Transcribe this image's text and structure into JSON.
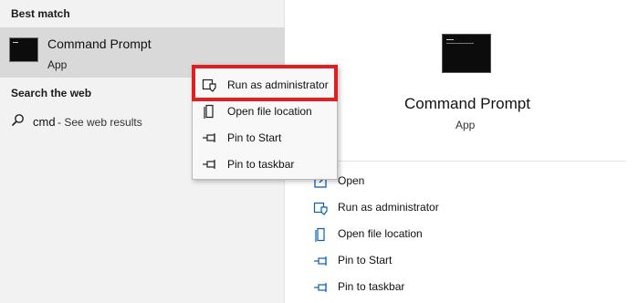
{
  "left": {
    "best_match_header": "Best match",
    "best_match": {
      "title": "Command Prompt",
      "subtitle": "App",
      "icon": "cmd-app-icon"
    },
    "search_web_header": "Search the web",
    "web_result": {
      "query": "cmd",
      "suffix": " - See web results",
      "icon": "search-icon"
    }
  },
  "context_menu": {
    "items": [
      {
        "label": "Run as administrator",
        "icon": "shield-icon"
      },
      {
        "label": "Open file location",
        "icon": "file-location-icon"
      },
      {
        "label": "Pin to Start",
        "icon": "pin-icon"
      },
      {
        "label": "Pin to taskbar",
        "icon": "pin-icon"
      }
    ],
    "highlight_color": "#e02020"
  },
  "details": {
    "title": "Command Prompt",
    "subtitle": "App",
    "icon": "cmd-app-icon",
    "actions": [
      {
        "label": "Open",
        "icon": "open-icon"
      },
      {
        "label": "Run as administrator",
        "icon": "shield-icon"
      },
      {
        "label": "Open file location",
        "icon": "file-location-icon"
      },
      {
        "label": "Pin to Start",
        "icon": "pin-icon"
      },
      {
        "label": "Pin to taskbar",
        "icon": "pin-icon"
      }
    ],
    "accent_color": "#0a5fb4"
  }
}
